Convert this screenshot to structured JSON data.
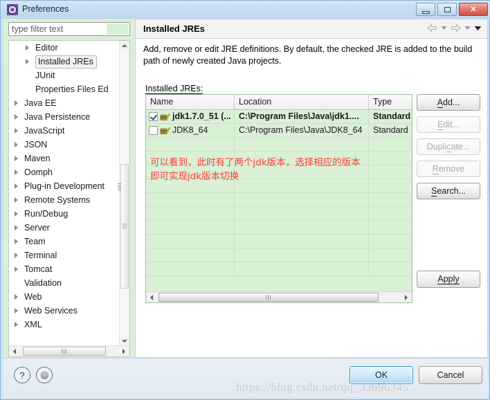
{
  "window": {
    "title": "Preferences",
    "icon": "preferences-gear-icon",
    "controls": {
      "minimize": "minimize-icon",
      "restore": "restore-icon",
      "close": "✕"
    }
  },
  "filter": {
    "placeholder": "type filter text",
    "value": ""
  },
  "tree": {
    "items": [
      {
        "label": "Editor",
        "level": 2,
        "arrow": true,
        "selected": false
      },
      {
        "label": "Installed JREs",
        "level": 2,
        "arrow": true,
        "selected": true
      },
      {
        "label": "JUnit",
        "level": 2,
        "arrow": false,
        "selected": false
      },
      {
        "label": "Properties Files Ed",
        "level": 2,
        "arrow": false,
        "selected": false
      },
      {
        "label": "Java EE",
        "level": 1,
        "arrow": true,
        "selected": false
      },
      {
        "label": "Java Persistence",
        "level": 1,
        "arrow": true,
        "selected": false
      },
      {
        "label": "JavaScript",
        "level": 1,
        "arrow": true,
        "selected": false
      },
      {
        "label": "JSON",
        "level": 1,
        "arrow": true,
        "selected": false
      },
      {
        "label": "Maven",
        "level": 1,
        "arrow": true,
        "selected": false
      },
      {
        "label": "Oomph",
        "level": 1,
        "arrow": true,
        "selected": false
      },
      {
        "label": "Plug-in Development",
        "level": 1,
        "arrow": true,
        "selected": false
      },
      {
        "label": "Remote Systems",
        "level": 1,
        "arrow": true,
        "selected": false
      },
      {
        "label": "Run/Debug",
        "level": 1,
        "arrow": true,
        "selected": false
      },
      {
        "label": "Server",
        "level": 1,
        "arrow": true,
        "selected": false
      },
      {
        "label": "Team",
        "level": 1,
        "arrow": true,
        "selected": false
      },
      {
        "label": "Terminal",
        "level": 1,
        "arrow": true,
        "selected": false
      },
      {
        "label": "Tomcat",
        "level": 1,
        "arrow": true,
        "selected": false
      },
      {
        "label": "Validation",
        "level": 1,
        "arrow": false,
        "selected": false
      },
      {
        "label": "Web",
        "level": 1,
        "arrow": true,
        "selected": false
      },
      {
        "label": "Web Services",
        "level": 1,
        "arrow": true,
        "selected": false
      },
      {
        "label": "XML",
        "level": 1,
        "arrow": true,
        "selected": false
      }
    ]
  },
  "panel": {
    "title": "Installed JREs",
    "description": "Add, remove or edit JRE definitions. By default, the checked JRE is added to the build path of newly created Java projects.",
    "table_label": "Installed JREs:",
    "nav": {
      "back": "back-arrow-icon",
      "back_menu": "back-dropdown-icon",
      "forward": "forward-arrow-icon",
      "forward_menu": "forward-dropdown-icon",
      "view_menu": "view-menu-icon"
    }
  },
  "table": {
    "columns": [
      "Name",
      "Location",
      "Type"
    ],
    "rows": [
      {
        "checked": true,
        "name": "jdk1.7.0_51 (...",
        "location": "C:\\Program Files\\Java\\jdk1....",
        "type": "Standard",
        "bold": true
      },
      {
        "checked": false,
        "name": "JDK8_64",
        "location": "C:\\Program Files\\Java\\JDK8_64",
        "type": "Standard",
        "bold": false
      }
    ],
    "empty_rows": 10
  },
  "annotation": {
    "line1": "可以看到，此时有了两个jdk版本，选择相应的版本",
    "line2": "即可实现jdk版本切换",
    "color": "#ff3c3c"
  },
  "side_buttons": [
    {
      "label": "Add...",
      "mnemonic": "A",
      "enabled": true
    },
    {
      "label": "Edit...",
      "mnemonic": "E",
      "enabled": false
    },
    {
      "label": "Duplicate...",
      "mnemonic": "c",
      "enabled": false
    },
    {
      "label": "Remove",
      "mnemonic": "R",
      "enabled": false
    },
    {
      "label": "Search...",
      "mnemonic": "S",
      "enabled": true
    }
  ],
  "apply_button": {
    "label": "Apply",
    "mnemonic": "A",
    "enabled": true
  },
  "footer": {
    "help_icon": "question-mark-icon",
    "extra_icon": "circle-dot-icon",
    "ok_label": "OK",
    "cancel_label": "Cancel"
  },
  "watermark": "https://blog.csdn.net/qq_33696345",
  "colors": {
    "left_panel_bg": "#d9f0d6",
    "table_bg": "#d9f0d6",
    "annotation_red": "#ff3c3c",
    "ok_accent": "#2f93cf",
    "close_red": "#cf5248"
  }
}
